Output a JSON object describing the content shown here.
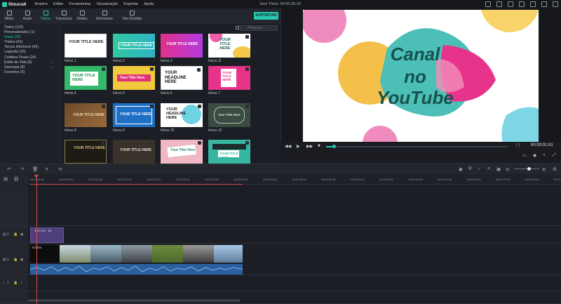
{
  "app": {
    "name": "filmora9",
    "window_title": "Sem Título: 00:00:30:14"
  },
  "menu": [
    "Arquivo",
    "Editar",
    "Ferramentas",
    "Visualização",
    "Exportar",
    "Ajuda"
  ],
  "tabs": [
    {
      "label": "Mídia",
      "icon": "folder-icon"
    },
    {
      "label": "Áudio",
      "icon": "music-icon"
    },
    {
      "label": "Títulos",
      "icon": "title-icon",
      "active": true
    },
    {
      "label": "Transições",
      "icon": "transition-icon"
    },
    {
      "label": "Efeitos",
      "icon": "effects-icon"
    },
    {
      "label": "Elementos",
      "icon": "elements-icon"
    },
    {
      "label": "Tela Dividida",
      "icon": "split-screen-icon"
    }
  ],
  "export_label": "EXPORTAR",
  "search_placeholder": "Pesquisa",
  "categories": [
    {
      "label": "Todos (131)"
    },
    {
      "label": "Personalizados (1)"
    },
    {
      "label": "Intros (25)",
      "active": true
    },
    {
      "label": "Títulos (41)"
    },
    {
      "label": "Terços Inferiores (42)"
    },
    {
      "label": "Legenda (15)"
    },
    {
      "label": "Créditos Finais (14)"
    },
    {
      "label": "Estilo de Vida (6)",
      "has_arrow": true
    },
    {
      "label": "Sazonais (8)",
      "has_arrow": true
    },
    {
      "label": "Favoritos (0)"
    }
  ],
  "thumbnails": [
    {
      "label": "Intros 1",
      "text": "YOUR TITLE HERE"
    },
    {
      "label": "Intros 2",
      "text": "YOUR TITLE HERE"
    },
    {
      "label": "Intros 3",
      "text": "YOUR TITLE HERE"
    },
    {
      "label": "Intros 11",
      "text": "YOUR TITLE HERE"
    },
    {
      "label": "Intros 4",
      "text": "YOUR TITLE HERE"
    },
    {
      "label": "Intros 5",
      "text": "Your Title Here"
    },
    {
      "label": "Intros 6",
      "text": "YOUR HEADLINE HERE"
    },
    {
      "label": "Intros 7",
      "text": "YOUR TITLE HERE"
    },
    {
      "label": "Intros 8",
      "text": "YOUR TITLE HERE"
    },
    {
      "label": "Intros 9",
      "text": "YOUR TITLE HERE"
    },
    {
      "label": "Intros 10",
      "text": "YOUR HEADLINE HERE"
    },
    {
      "label": "Intros 12",
      "text": "Your Title Here"
    },
    {
      "label": "",
      "text": "YOUR TITLE HERE"
    },
    {
      "label": "",
      "text": "YOUR TITLE HERE"
    },
    {
      "label": "",
      "text": "Your Title Here"
    },
    {
      "label": "",
      "text": "YOUR TITLE HERE"
    }
  ],
  "preview": {
    "line1": "Canal",
    "line2": "no",
    "line3": "YouTube",
    "timecode": "00:00:01:01",
    "brackets": "{  }"
  },
  "ruler_ticks": [
    "00:00:00:00",
    "00:00:05:00",
    "00:00:10:00",
    "00:00:15:00",
    "00:00:20:00",
    "00:00:25:00",
    "00:00:30:00",
    "00:00:35:00",
    "00:00:40:00",
    "00:00:45:00",
    "00:00:50:00",
    "00:00:55:00",
    "00:01:00:00",
    "00:01:05:00",
    "00:01:10:00",
    "00:01:15:00",
    "00:01:20:00",
    "00:01:25:00",
    "00:01:30:00"
  ],
  "tracks": {
    "title_track": "2",
    "video_track": "1",
    "audio_track": "1"
  },
  "clips": {
    "title_clip": "Intros 11",
    "video_clip": "Vídeo"
  },
  "colors": {
    "accent": "#29c7b2",
    "playhead": "#e04848",
    "title_clip": "#4e3e7a",
    "audio_clip": "#2b5f9e"
  }
}
